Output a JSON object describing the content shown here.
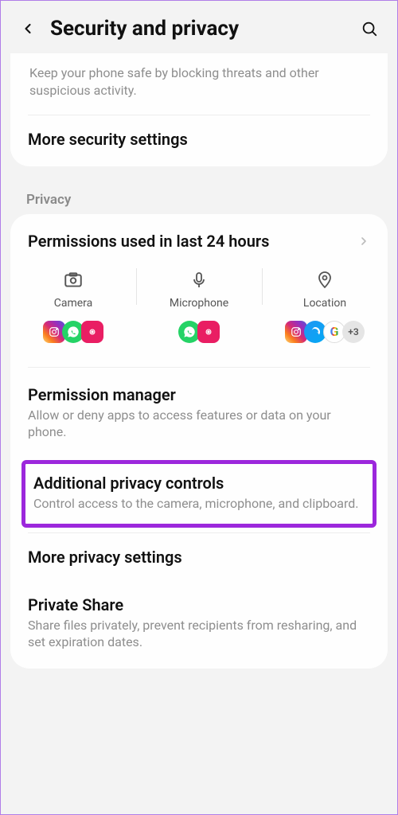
{
  "header": {
    "title": "Security and privacy"
  },
  "topCard": {
    "description": "Keep your phone safe by blocking threats and other suspicious activity.",
    "moreSecurity": "More security settings"
  },
  "privacy": {
    "sectionHeader": "Privacy",
    "permissionsUsed": {
      "title": "Permissions used in last 24 hours"
    },
    "columns": {
      "camera": "Camera",
      "microphone": "Microphone",
      "location": "Location",
      "locationMore": "+3"
    },
    "permissionManager": {
      "title": "Permission manager",
      "sub": "Allow or deny apps to access features or data on your phone."
    },
    "additionalPrivacy": {
      "title": "Additional privacy controls",
      "sub": "Control access to the camera, microphone, and clipboard."
    },
    "morePrivacy": {
      "title": "More privacy settings"
    },
    "privateShare": {
      "title": "Private Share",
      "sub": "Share files privately, prevent recipients from resharing, and set expiration dates."
    }
  }
}
